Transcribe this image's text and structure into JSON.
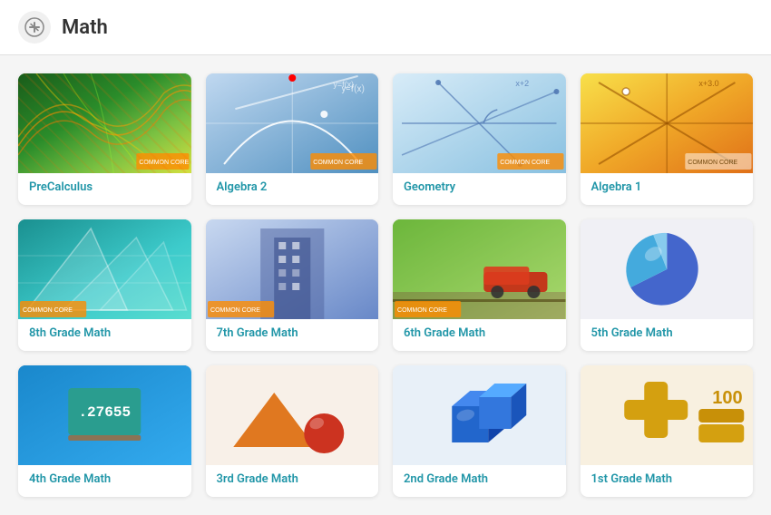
{
  "header": {
    "title": "Math",
    "icon_symbol": "⚡"
  },
  "courses": [
    {
      "id": "precalculus",
      "label": "PreCalculus",
      "thumb_class": "thumb-precalc",
      "row": 0
    },
    {
      "id": "algebra2",
      "label": "Algebra 2",
      "thumb_class": "thumb-algebra2",
      "row": 0
    },
    {
      "id": "geometry",
      "label": "Geometry",
      "thumb_class": "thumb-geometry",
      "row": 0
    },
    {
      "id": "algebra1",
      "label": "Algebra 1",
      "thumb_class": "thumb-algebra1",
      "row": 0
    },
    {
      "id": "8th-grade",
      "label": "8th Grade Math",
      "thumb_class": "thumb-8th",
      "row": 1
    },
    {
      "id": "7th-grade",
      "label": "7th Grade Math",
      "thumb_class": "thumb-7th",
      "row": 1
    },
    {
      "id": "6th-grade",
      "label": "6th Grade Math",
      "thumb_class": "thumb-6th",
      "row": 1
    },
    {
      "id": "5th-grade",
      "label": "5th Grade Math",
      "thumb_class": "thumb-5th",
      "row": 1
    },
    {
      "id": "4th-grade",
      "label": "4th Grade Math",
      "thumb_class": "thumb-4th",
      "row": 2
    },
    {
      "id": "3rd-grade",
      "label": "3rd Grade Math",
      "thumb_class": "thumb-3rd",
      "row": 2
    },
    {
      "id": "2nd-grade",
      "label": "2nd Grade Math",
      "thumb_class": "thumb-2nd",
      "row": 2
    },
    {
      "id": "1st-grade",
      "label": "1st Grade Math",
      "thumb_class": "thumb-1st",
      "row": 2
    }
  ]
}
